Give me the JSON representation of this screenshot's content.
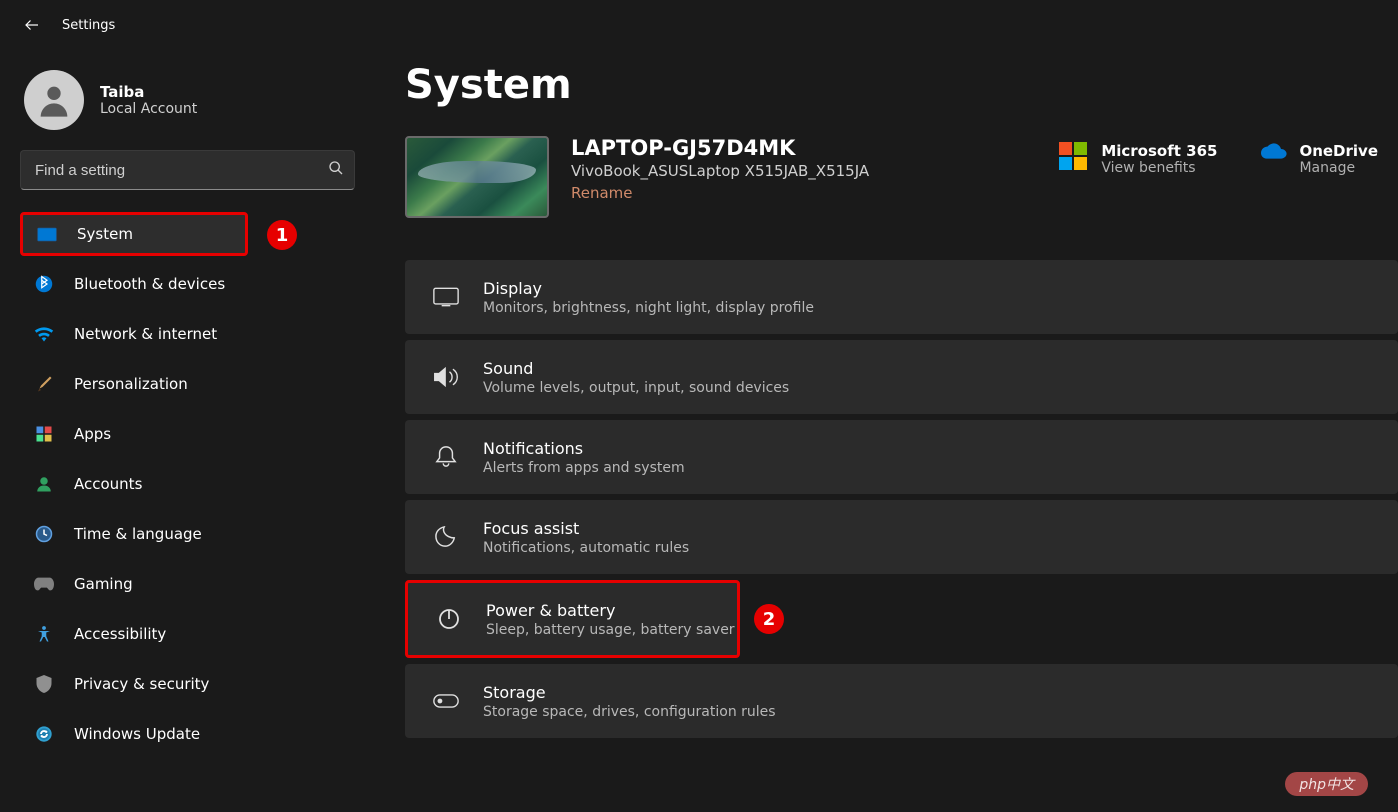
{
  "app_title": "Settings",
  "profile": {
    "name": "Taiba",
    "sub": "Local Account"
  },
  "search": {
    "placeholder": "Find a setting"
  },
  "nav": {
    "items": [
      {
        "label": "System"
      },
      {
        "label": "Bluetooth & devices"
      },
      {
        "label": "Network & internet"
      },
      {
        "label": "Personalization"
      },
      {
        "label": "Apps"
      },
      {
        "label": "Accounts"
      },
      {
        "label": "Time & language"
      },
      {
        "label": "Gaming"
      },
      {
        "label": "Accessibility"
      },
      {
        "label": "Privacy & security"
      },
      {
        "label": "Windows Update"
      }
    ]
  },
  "page_title": "System",
  "device": {
    "name": "LAPTOP-GJ57D4MK",
    "model": "VivoBook_ASUSLaptop X515JAB_X515JA",
    "rename": "Rename"
  },
  "tiles": {
    "m365": {
      "title": "Microsoft 365",
      "sub": "View benefits"
    },
    "onedrive": {
      "title": "OneDrive",
      "sub": "Manage"
    }
  },
  "settings": [
    {
      "title": "Display",
      "sub": "Monitors, brightness, night light, display profile"
    },
    {
      "title": "Sound",
      "sub": "Volume levels, output, input, sound devices"
    },
    {
      "title": "Notifications",
      "sub": "Alerts from apps and system"
    },
    {
      "title": "Focus assist",
      "sub": "Notifications, automatic rules"
    },
    {
      "title": "Power & battery",
      "sub": "Sleep, battery usage, battery saver"
    },
    {
      "title": "Storage",
      "sub": "Storage space, drives, configuration rules"
    }
  ],
  "markers": {
    "one": "1",
    "two": "2"
  },
  "watermark": "php中文"
}
